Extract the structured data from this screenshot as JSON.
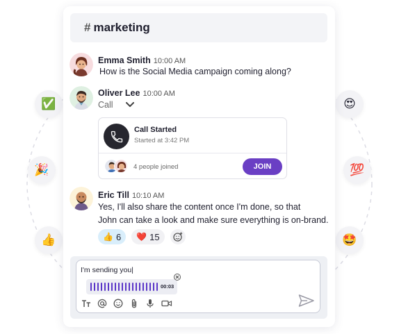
{
  "channel": {
    "hash": "#",
    "name": "marketing"
  },
  "messages": [
    {
      "author": "Emma Smith",
      "time": "10:00 AM",
      "text": "How is the Social Media campaign coming along?"
    },
    {
      "author": "Oliver Lee",
      "time": "10:00 AM",
      "text": "Call"
    },
    {
      "author": "Eric Till",
      "time": "10:10 AM",
      "lines": [
        "Yes, I'll also share the content once I'm done, so that",
        "John can take a look and make sure everything is on-brand."
      ]
    }
  ],
  "call": {
    "title": "Call Started",
    "subtitle": "Started at 3:42 PM",
    "joined": "4 people joined",
    "join_label": "JOIN"
  },
  "reactions": [
    {
      "emoji": "👍",
      "count": "6",
      "active": true
    },
    {
      "emoji": "❤️",
      "count": "15",
      "active": false
    }
  ],
  "floating_emojis": {
    "left": [
      "✅",
      "🎉",
      "👍"
    ],
    "right": [
      "😍",
      "💯",
      "🤩"
    ]
  },
  "composer": {
    "value": "I'm sending you|",
    "voice_duration": "00:03"
  },
  "colors": {
    "accent": "#6a3fc4",
    "voice_bars": "#5a35c8",
    "reaction_active": "#d9eefb"
  },
  "icons": [
    "hash-icon",
    "chevron-down-icon",
    "phone-icon",
    "add-reaction-icon",
    "text-format-icon",
    "mention-icon",
    "emoji-icon",
    "attachment-icon",
    "microphone-icon",
    "video-icon",
    "send-icon",
    "close-icon"
  ]
}
